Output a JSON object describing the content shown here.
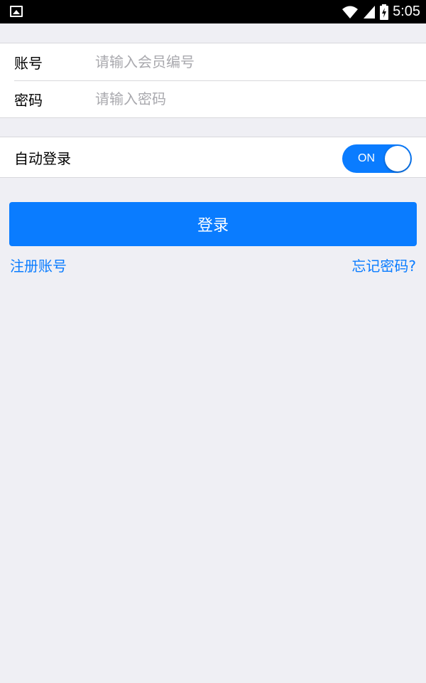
{
  "status_bar": {
    "time": "5:05",
    "icons": [
      "image-icon",
      "wifi-icon",
      "cell-signal-icon",
      "battery-charging-icon"
    ]
  },
  "account_form": {
    "account_label": "账号",
    "account_placeholder": "请输入会员编号",
    "password_label": "密码",
    "password_placeholder": "请输入密码"
  },
  "auto_login": {
    "label": "自动登录",
    "toggle_state": "ON"
  },
  "actions": {
    "login_label": "登录",
    "register_label": "注册账号",
    "forgot_label": "忘记密码?"
  },
  "colors": {
    "accent": "#0a7cff",
    "background": "#efeff4"
  }
}
